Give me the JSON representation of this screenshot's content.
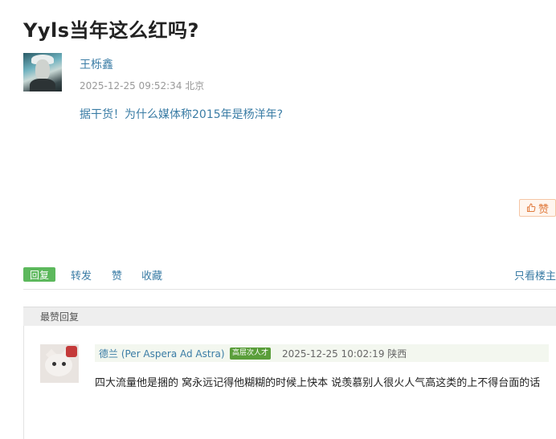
{
  "post": {
    "title": "Yyls当年这么红吗?",
    "author": "王栎鑫",
    "timestamp": "2025-12-25 09:52:34",
    "location": "北京",
    "content": "据干货！为什么媒体称2015年是杨洋年?",
    "like_label": "赞"
  },
  "actions": {
    "reply": "回复",
    "forward": "转发",
    "like": "赞",
    "favorite": "收藏",
    "only_op": "只看楼主"
  },
  "best_replies": {
    "header": "最赞回复",
    "items": [
      {
        "user": "德兰 (Per Aspera Ad Astra)",
        "tag": "高层次人才",
        "timestamp": "2025-12-25 10:02:19",
        "location": "陕西",
        "text": "四大流量他是捆的 窝永远记得他糊糊的时候上快本 说羡慕别人很火人气高这类的上不得台面的话"
      }
    ]
  },
  "colors": {
    "link": "#3a7ca5",
    "reply_tag": "#5cb85c",
    "like_accent": "#e07a3c",
    "talent_tag": "#5a9e3a"
  }
}
